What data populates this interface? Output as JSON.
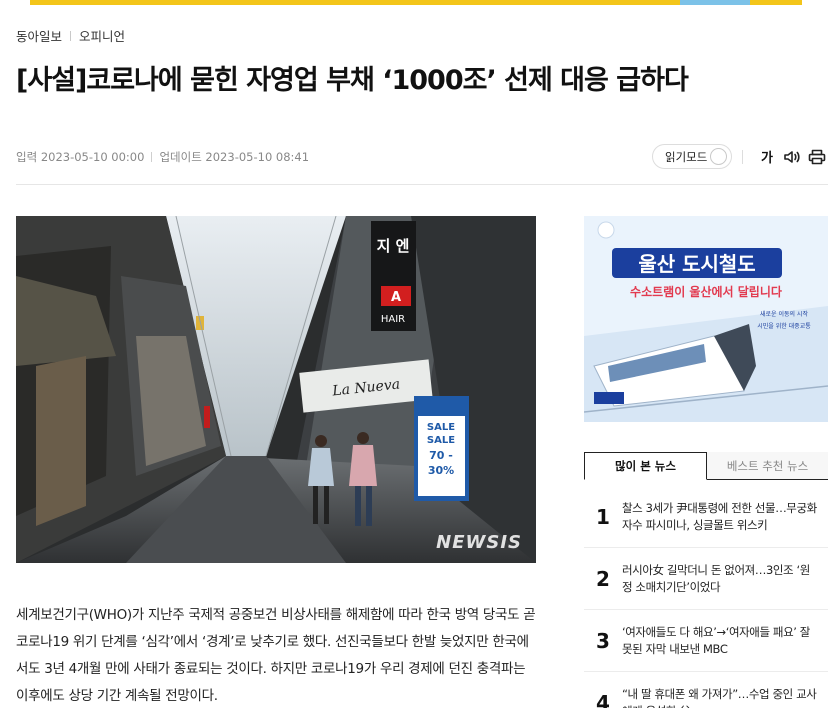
{
  "colors": {
    "accent": "#f3c51a",
    "text": "#111111",
    "muted": "#888888"
  },
  "breadcrumb": {
    "site": "동아일보",
    "section": "오피니언"
  },
  "article": {
    "title": "[사설]코로나에 묻힌 자영업 부채 ‘1000조’ 선제 대응 급하다",
    "published": "입력 2023-05-10 00:00",
    "updated": "업데이트 2023-05-10 08:41",
    "photo_credit": "NEWSIS",
    "photo_shop_sign": "La Nueva",
    "photo_hair_sign": "HAIR",
    "photo_hair_letter": "A",
    "photo_vertical_sign": "지 엔",
    "photo_sale_lines": [
      "SALE",
      "SALE",
      "70 -",
      "30%"
    ],
    "body": "세계보건기구(WHO)가 지난주 국제적 공중보건 비상사태를 해제함에 따라 한국 방역 당국도 곧 코로나19 위기 단계를 ‘심각’에서 ‘경계’로 낮추기로 했다. 선진국들보다 한발 늦었지만 한국에서도 3년 4개월 만에 사태가 종료되는 것이다. 하지만 코로나19가 우리 경제에 던진 충격파는 이후에도 상당 기간 계속될 전망이다."
  },
  "tools": {
    "readmode_label": "읽기모드",
    "font_label": "가",
    "icons": [
      "speaker-icon",
      "print-icon"
    ]
  },
  "ad": {
    "title": "울산 도시철도",
    "subtitle": "수소트램이 울산에서 달립니다",
    "tag1": "새로운 이동의 시작",
    "tag2": "시민을 위한 대중교통"
  },
  "ranking": {
    "tabs": [
      "많이 본 뉴스",
      "베스트 추천 뉴스"
    ],
    "items": [
      {
        "rank": "1",
        "title": "찰스 3세가 尹대통령에 전한 선물…무궁화 자수 파시미나, 싱글몰트 위스키"
      },
      {
        "rank": "2",
        "title": "러시아女 길막더니 돈 없어져…3인조 ‘원정 소매치기단’이었다"
      },
      {
        "rank": "3",
        "title": "‘여자애들도 다 해요’→‘여자애들 패요’ 잘못된 자막 내보낸 MBC"
      },
      {
        "rank": "4",
        "title": "“내 딸 휴대폰 왜 가져가”…수업 중인 교사에게 욕설한 父"
      }
    ]
  }
}
